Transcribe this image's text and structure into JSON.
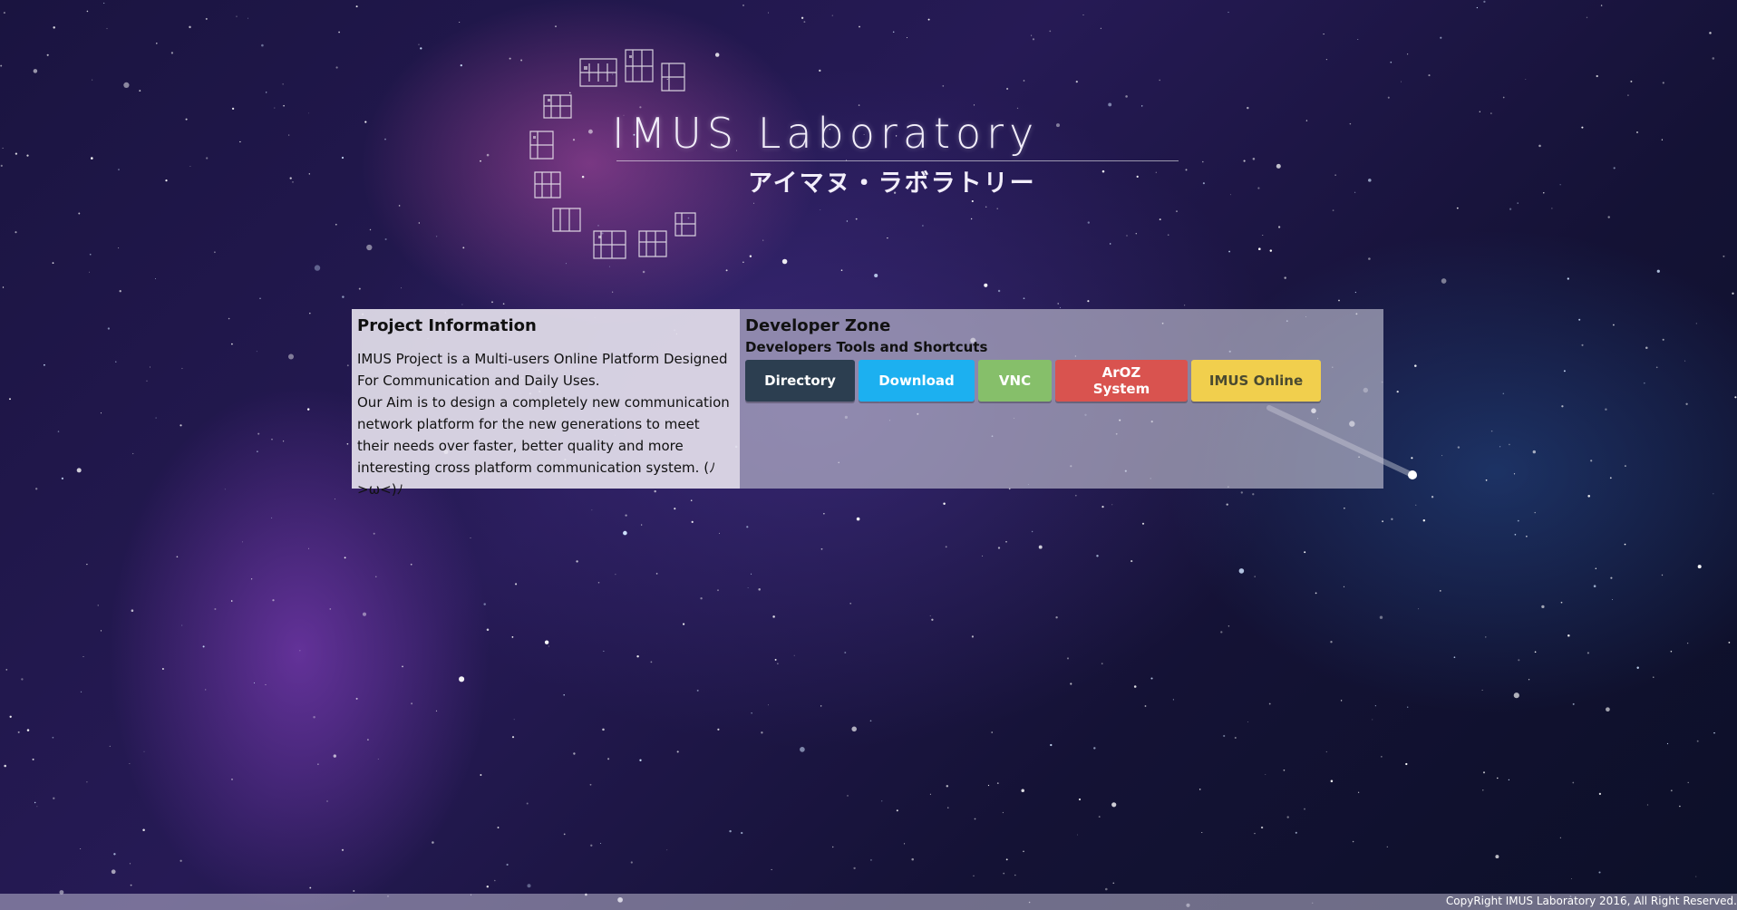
{
  "header": {
    "title": "IMUS Laboratory",
    "subtitle": "アイマヌ・ラボラトリー"
  },
  "info_panel": {
    "title": "Project Information",
    "paragraph_1": "IMUS Project is a Multi-users Online Platform Designed For Communication and Daily Uses.",
    "paragraph_2": "Our Aim is to design a completely new communication network platform for the new generations to meet their needs over faster, better quality and more interesting cross platform communication system. (ﾉ>ω<)ﾉ"
  },
  "dev_panel": {
    "title": "Developer Zone",
    "subtitle": "Developers Tools and Shortcuts",
    "buttons": [
      {
        "label": "Directory",
        "color": "#2c3e50"
      },
      {
        "label": "Download",
        "color": "#1cb0f0"
      },
      {
        "label": "VNC",
        "color": "#86bf6a"
      },
      {
        "label": "ArOZ System",
        "color": "#d9534f"
      },
      {
        "label": "IMUS Online",
        "color": "#f1cf4d"
      }
    ]
  },
  "footer": {
    "copyright": "CopyRight IMUS Laboratory 2016, All Right Reserved."
  }
}
